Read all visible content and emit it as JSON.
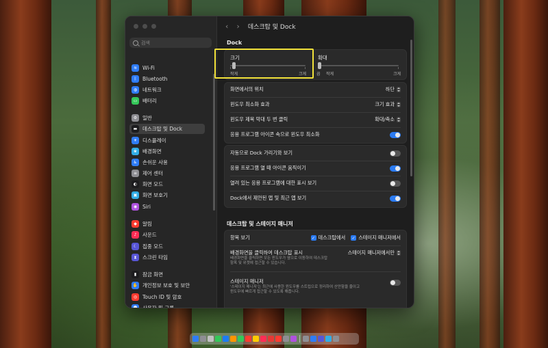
{
  "search": {
    "placeholder": "검색"
  },
  "sidebar": {
    "items": [
      {
        "label": "Wi-Fi",
        "icon": "wifi-icon",
        "color": "#2f7cf6",
        "glyph": "≋"
      },
      {
        "label": "Bluetooth",
        "icon": "bluetooth-icon",
        "color": "#2f7cf6",
        "glyph": "ᛒ"
      },
      {
        "label": "네트워크",
        "icon": "network-icon",
        "color": "#2f7cf6",
        "glyph": "◍"
      },
      {
        "label": "배터리",
        "icon": "battery-icon",
        "color": "#34c759",
        "glyph": "▭"
      },
      {
        "label": "일반",
        "icon": "gear-icon",
        "color": "#8e8e93",
        "glyph": "⚙"
      },
      {
        "label": "데스크탑 및 Dock",
        "icon": "dock-icon",
        "color": "#1c1c1e",
        "glyph": "▬"
      },
      {
        "label": "디스플레이",
        "icon": "display-icon",
        "color": "#2f7cf6",
        "glyph": "☀"
      },
      {
        "label": "배경화면",
        "icon": "wallpaper-icon",
        "color": "#32ade6",
        "glyph": "❀"
      },
      {
        "label": "손쉬운 사용",
        "icon": "accessibility-icon",
        "color": "#2f7cf6",
        "glyph": "♿"
      },
      {
        "label": "제어 센터",
        "icon": "control-center-icon",
        "color": "#8e8e93",
        "glyph": "≡"
      },
      {
        "label": "화면 모드",
        "icon": "appearance-icon",
        "color": "#1c1c1e",
        "glyph": "◐"
      },
      {
        "label": "화면 보호기",
        "icon": "screensaver-icon",
        "color": "#32ade6",
        "glyph": "▣"
      },
      {
        "label": "Siri",
        "icon": "siri-icon",
        "color": "#af52de",
        "glyph": "◉"
      },
      {
        "label": "알림",
        "icon": "bell-icon",
        "color": "#ff3b30",
        "glyph": "◆"
      },
      {
        "label": "사운드",
        "icon": "speaker-icon",
        "color": "#ff2d55",
        "glyph": "♪"
      },
      {
        "label": "집중 모드",
        "icon": "moon-icon",
        "color": "#5856d6",
        "glyph": "☾"
      },
      {
        "label": "스크린 타임",
        "icon": "hourglass-icon",
        "color": "#5856d6",
        "glyph": "⧗"
      },
      {
        "label": "잠금 화면",
        "icon": "lock-icon",
        "color": "#1c1c1e",
        "glyph": "▮"
      },
      {
        "label": "개인정보 보호 및 보안",
        "icon": "hand-icon",
        "color": "#2f7cf6",
        "glyph": "✋"
      },
      {
        "label": "Touch ID 및 암호",
        "icon": "fingerprint-icon",
        "color": "#ff3b30",
        "glyph": "◎"
      },
      {
        "label": "사용자 및 그룹",
        "icon": "users-icon",
        "color": "#2f7cf6",
        "glyph": "☻"
      }
    ]
  },
  "window": {
    "title": "데스크탑 및 Dock",
    "back": "‹",
    "forward": "›"
  },
  "dock_section": {
    "title": "Dock",
    "size": {
      "label": "크기",
      "min": "작게",
      "max": "크게",
      "value": 0.03
    },
    "magnify": {
      "label": "확대",
      "off": "끔",
      "min": "작게",
      "max": "크게",
      "value": 0.0
    },
    "rows": [
      {
        "label": "화면에서의 위치",
        "value": "하단"
      },
      {
        "label": "윈도우 최소화 효과",
        "value": "크기 효과"
      },
      {
        "label": "윈도우 제목 막대 두 번 클릭",
        "value": "확대/축소"
      },
      {
        "label": "응용 프로그램 아이콘 속으로 윈도우 최소화",
        "toggle": true
      }
    ],
    "rows2": [
      {
        "label": "자동으로 Dock 가리기와 보기",
        "toggle": false
      },
      {
        "label": "응용 프로그램 열 때 아이콘 움직이기",
        "toggle": true
      },
      {
        "label": "열려 있는 응용 프로그램에 대한 표시 보기",
        "toggle": false
      },
      {
        "label": "Dock에서 제안된 앱 및 최근 앱 보기",
        "toggle": true
      }
    ]
  },
  "stage_section": {
    "title": "데스크탑 및 스테이지 매니저",
    "show_items": {
      "label": "항목 보기",
      "opt1": "데스크탑에서",
      "opt2": "스테이지 매니저에서"
    },
    "click_wallpaper": {
      "label": "배경화면을 클릭하여 데스크탑 표시",
      "desc1": "배경화면을 클릭하면 모든 윈도우가 옆으로 이동하여 데스크탑",
      "desc2": "항목 및 위젯에 접근할 수 있습니다.",
      "value": "스테이지 매니저에서만"
    },
    "stage_manager": {
      "label": "스테이지 매니저",
      "desc1": "'스테이지 매니저'는 최근에 사용한 윈도우를 스트립으로 정리하여 산만함을 줄이고",
      "desc2": "윈도우에 빠르게 접근할 수 있도록 해줍니다.",
      "toggle": false
    }
  },
  "dock_icons": [
    "#2f7cf6",
    "#8e8e93",
    "#c0c0c0",
    "#34c759",
    "#1c7cf2",
    "#ff9500",
    "#34c759",
    "#ff3b30",
    "#ffcc00",
    "#ff2d55",
    "#e53935",
    "#ff3b30",
    "#8e8e93",
    "#af52de",
    "#8e8e93",
    "#2f7cf6",
    "#5856d6",
    "#32ade6",
    "#8e8e93"
  ]
}
